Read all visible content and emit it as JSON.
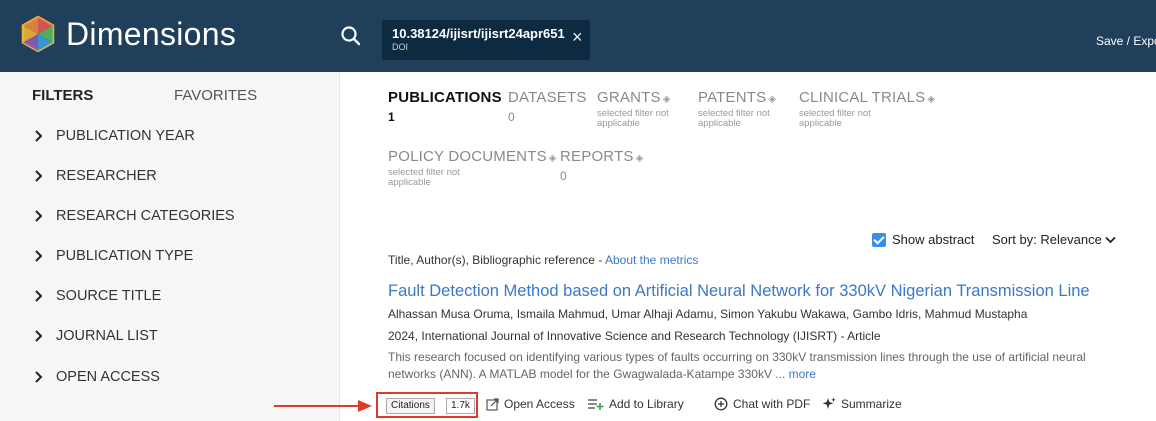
{
  "header": {
    "brand": "Dimensions",
    "search_chip": {
      "value": "10.38124/ijisrt/ijisrt24apr651",
      "label": "DOI",
      "close": "×"
    },
    "save_export": "Save / Export"
  },
  "sidebar": {
    "tabs": [
      {
        "label": "FILTERS"
      },
      {
        "label": "FAVORITES"
      }
    ],
    "filters": [
      {
        "label": "PUBLICATION YEAR"
      },
      {
        "label": "RESEARCHER"
      },
      {
        "label": "RESEARCH CATEGORIES"
      },
      {
        "label": "PUBLICATION TYPE"
      },
      {
        "label": "SOURCE TITLE"
      },
      {
        "label": "JOURNAL LIST"
      },
      {
        "label": "OPEN ACCESS"
      }
    ]
  },
  "content_tabs": [
    {
      "name": "PUBLICATIONS",
      "count": "1"
    },
    {
      "name": "DATASETS",
      "count": "0"
    },
    {
      "name": "GRANTS",
      "note": "selected filter not applicable"
    },
    {
      "name": "PATENTS",
      "note": "selected filter not applicable"
    },
    {
      "name": "CLINICAL TRIALS",
      "note": "selected filter not applicable"
    },
    {
      "name": "POLICY DOCUMENTS",
      "note": "selected filter not applicable"
    },
    {
      "name": "REPORTS",
      "count": "0"
    }
  ],
  "toolbar": {
    "show_abstract": "Show abstract",
    "sort": "Sort by: Relevance",
    "metrics_prefix": "Title, Author(s), Bibliographic reference - ",
    "metrics_link": "About the metrics"
  },
  "result": {
    "title": "Fault Detection Method based on Artificial Neural Network for 330kV Nigerian Transmission Line",
    "authors": "Alhassan Musa Oruma, Ismaila Mahmud, Umar Alhaji Adamu, Simon Yakubu Wakawa, Gambo Idris, Mahmud Mustapha",
    "reference": "2024, International Journal of Innovative Science and Research Technology (IJISRT) - Article",
    "abstract": "This research focused on identifying various types of faults occurring on 330kV transmission lines through the use of artificial neural networks (ANN). A MATLAB model for the Gwagwalada-Katampe 330kV ... ",
    "more": "more"
  },
  "actions": {
    "citations_label": "Citations",
    "citations_count": "1.7k",
    "open_access": "Open Access",
    "add_to_library": "Add to Library",
    "chat_pdf": "Chat with PDF",
    "summarize": "Summarize"
  },
  "colors": {
    "header_bg": "#1f3f5a",
    "link": "#3a78c9",
    "highlight": "#e03a2c",
    "checkbox": "#3a8ee6"
  }
}
